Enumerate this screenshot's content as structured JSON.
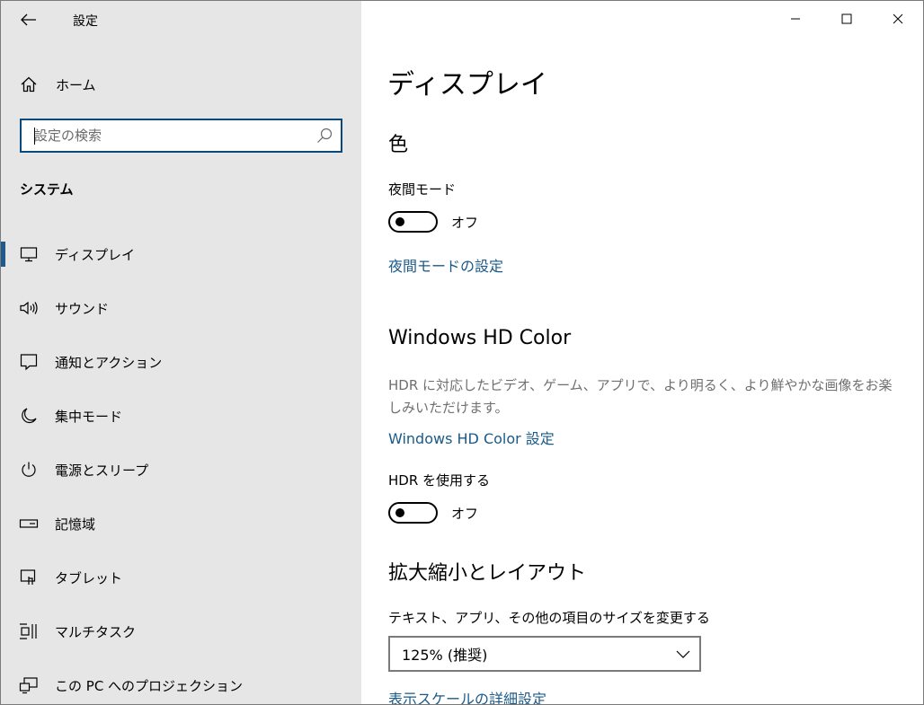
{
  "app": {
    "title": "設定"
  },
  "sidebar": {
    "home_label": "ホーム",
    "search_placeholder": "設定の検索",
    "section_title": "システム",
    "items": [
      {
        "label": "ディスプレイ",
        "icon": "monitor-icon",
        "active": true
      },
      {
        "label": "サウンド",
        "icon": "speaker-icon"
      },
      {
        "label": "通知とアクション",
        "icon": "notification-icon"
      },
      {
        "label": "集中モード",
        "icon": "moon-icon"
      },
      {
        "label": "電源とスリープ",
        "icon": "power-icon"
      },
      {
        "label": "記憶域",
        "icon": "storage-icon"
      },
      {
        "label": "タブレット",
        "icon": "tablet-icon"
      },
      {
        "label": "マルチタスク",
        "icon": "multitask-icon"
      },
      {
        "label": "この PC へのプロジェクション",
        "icon": "projection-icon"
      }
    ]
  },
  "main": {
    "page_title": "ディスプレイ",
    "color_section": {
      "heading": "色",
      "night_mode_label": "夜間モード",
      "night_mode_state": "オフ",
      "night_mode_link": "夜間モードの設定"
    },
    "hdr_section": {
      "heading": "Windows HD Color",
      "description": "HDR に対応したビデオ、ゲーム、アプリで、より明るく、より鮮やかな画像をお楽しみいただけます。",
      "link": "Windows HD Color 設定",
      "hdr_label": "HDR を使用する",
      "hdr_state": "オフ"
    },
    "scale_section": {
      "heading": "拡大縮小とレイアウト",
      "size_label": "テキスト、アプリ、その他の項目のサイズを変更する",
      "size_value": "125% (推奨)",
      "advanced_link": "表示スケールの詳細設定"
    }
  },
  "colors": {
    "sidebar_bg": "#e6e6e6",
    "accent": "#1e5a8c",
    "link": "#1a5a8a"
  }
}
